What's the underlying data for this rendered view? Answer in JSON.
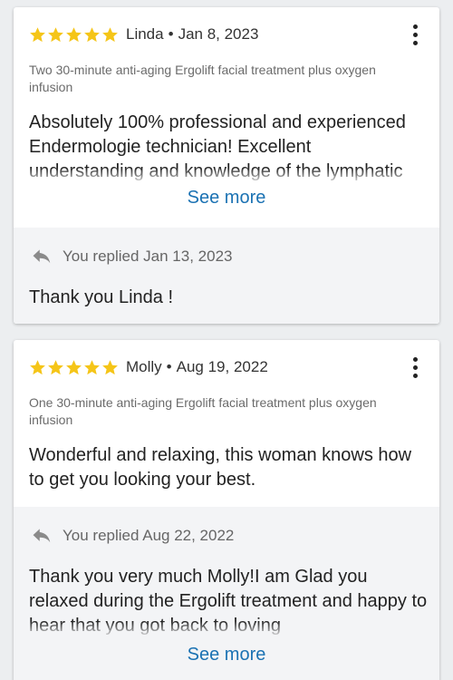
{
  "reviews": [
    {
      "rating": 5,
      "reviewer": "Linda",
      "date": "Jan 8, 2023",
      "separator": "•",
      "service": "Two 30-minute anti-aging Ergolift facial treatment plus oxygen infusion",
      "text": "Absolutely 100% professional and experienced Endermologie technician! Excellent understanding and  knowledge of the lymphatic",
      "see_more": "See more",
      "reply": {
        "label": "You replied Jan 13, 2023",
        "text": "Thank you Linda !"
      }
    },
    {
      "rating": 5,
      "reviewer": "Molly",
      "date": "Aug 19, 2022",
      "separator": "•",
      "service": "One 30-minute anti-aging Ergolift facial treatment plus oxygen infusion",
      "text": "Wonderful and relaxing, this woman knows how to get you looking your best.",
      "reply": {
        "label": "You replied Aug 22, 2022",
        "text": "Thank you very much Molly!I am  Glad you relaxed during the Ergolift  treatment and happy to hear that you got back to loving",
        "see_more": "See more"
      }
    }
  ],
  "icons": {
    "star": "star-icon",
    "menu": "more-vertical-icon",
    "reply": "reply-arrow-icon"
  },
  "colors": {
    "star": "#f5c518",
    "link": "#1b72b3",
    "reply_background": "#f3f4f6",
    "page_background": "#eceef0"
  }
}
